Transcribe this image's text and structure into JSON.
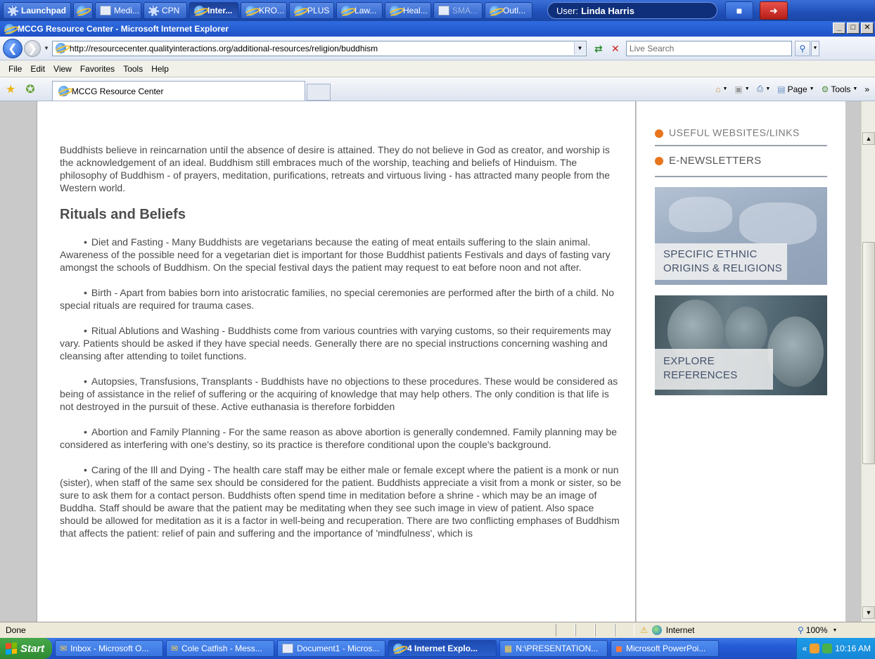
{
  "launchpad": {
    "launch_label": "Launchpad",
    "buttons": [
      "Medi...",
      "CPN",
      "Inter...",
      "KRO...",
      "PLUS",
      "Law...",
      "Heal...",
      "SMA...",
      "Outl..."
    ],
    "user_prefix": "User:",
    "user_name": "Linda Harris"
  },
  "window": {
    "title": "MCCG Resource Center - Microsoft Internet Explorer"
  },
  "address": {
    "url": "http://resourcecenter.qualityinteractions.org/additional-resources/religion/buddhism",
    "search_placeholder": "Live Search"
  },
  "menu": [
    "File",
    "Edit",
    "View",
    "Favorites",
    "Tools",
    "Help"
  ],
  "tab": {
    "title": "MCCG Resource Center"
  },
  "commands": {
    "page": "Page",
    "tools": "Tools"
  },
  "article": {
    "intro": "Buddhists believe in reincarnation until the absence of desire is attained. They do not believe in God as creator, and worship is the acknowledgement of an ideal. Buddhism still embraces much of the worship, teaching and beliefs of Hinduism. The philosophy of Buddhism - of prayers, meditation, purifications, retreats and virtuous living - has attracted many people from the Western world.",
    "heading": "Rituals and Beliefs",
    "items": [
      "Diet and Fasting - Many Buddhists are vegetarians because the eating of meat entails suffering to the slain animal. Awareness of the possible need for a vegetarian diet is important for those Buddhist patients Festivals and days of fasting vary amongst the schools of Buddhism. On the special festival days the patient may request to eat before noon and not after.",
      "Birth - Apart from babies born into aristocratic families, no special ceremonies are performed after the birth of a child. No special rituals are required for trauma cases.",
      "Ritual Ablutions and Washing - Buddhists come from various countries with varying customs, so their requirements may vary. Patients should be asked if they have special needs. Generally there are no special instructions concerning washing and cleansing after attending to toilet functions.",
      "Autopsies, Transfusions, Transplants - Buddhists have no objections to these procedures. These would be considered as being of assistance in the relief of suffering or the acquiring of knowledge that may help others. The only condition is that life is not destroyed in the pursuit of these. Active euthanasia is therefore forbidden",
      "Abortion and Family Planning - For the same reason as above abortion is generally condemned. Family planning may be considered as interfering with one's destiny, so its practice is therefore conditional upon the couple's background.",
      "Caring of the Ill and Dying - The health care staff may be either male or female except where the patient is a monk or nun (sister), when staff of the same sex should be considered for the patient. Buddhists appreciate a visit from a monk or sister, so be sure to ask them for a contact person. Buddhists often spend time in meditation before a shrine - which may be an image of Buddha. Staff should be aware that the patient may be meditating when they see such image in view of patient. Also space should be allowed for meditation as it is a factor in well-being and recuperation. There are two conflicting emphases of Buddhism that affects the patient: relief of pain and suffering and the importance of 'mindfulness', which is"
    ]
  },
  "sidebar": {
    "useful_links": "USEFUL WEBSITES/LINKS",
    "enewsletters": "E-NEWSLETTERS",
    "ethnic_line1": "SPECIFIC ETHNIC",
    "ethnic_line2": "ORIGINS & RELIGIONS",
    "explore_line1": "EXPLORE",
    "explore_line2": "REFERENCES"
  },
  "status": {
    "text": "Done",
    "zone": "Internet",
    "zoom": "100%"
  },
  "taskbar": {
    "start": "Start",
    "buttons": [
      "Inbox - Microsoft O...",
      "Cole Catfish - Mess...",
      "Document1 - Micros...",
      "4 Internet Explo...",
      "N:\\PRESENTATION...",
      "Microsoft PowerPoi..."
    ],
    "clock": "10:16 AM"
  },
  "colors": {
    "accent_orange": "#e8741c",
    "xp_blue": "#245bd6",
    "text_gray": "#4a4a4a"
  }
}
